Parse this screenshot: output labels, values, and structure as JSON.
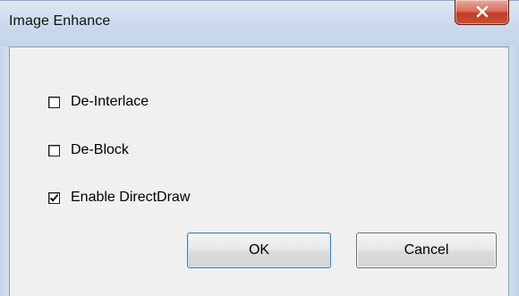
{
  "window": {
    "title": "Image Enhance",
    "close_icon": "close-icon"
  },
  "options": [
    {
      "label": "De-Interlace",
      "checked": false
    },
    {
      "label": "De-Block",
      "checked": false
    },
    {
      "label": "Enable DirectDraw",
      "checked": true
    }
  ],
  "buttons": {
    "ok_label": "OK",
    "cancel_label": "Cancel"
  },
  "colors": {
    "close_button": "#c9502f",
    "dialog_background": "#f0f0f0",
    "frame": "#c9d8ea"
  }
}
